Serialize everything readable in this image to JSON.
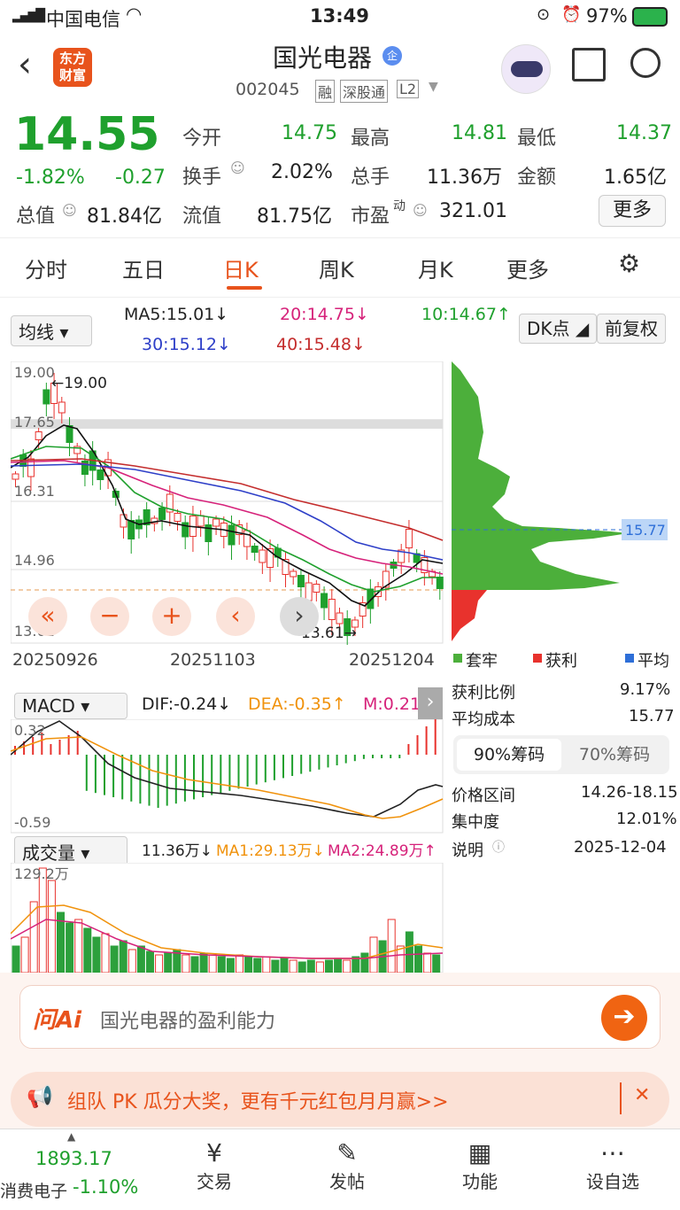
{
  "status": {
    "carrier": "中国电信",
    "time": "13:49",
    "battery": "97%"
  },
  "nav": {
    "logo_line1": "东方",
    "logo_line2": "财富",
    "stock_name": "国光电器",
    "badge": "企",
    "code": "002045",
    "tag1": "融",
    "tag2": "深股通",
    "tag3": "L2"
  },
  "quote": {
    "price": "14.55",
    "pct": "-1.82%",
    "chg": "-0.27",
    "open_label": "今开",
    "open": "14.75",
    "high_label": "最高",
    "high": "14.81",
    "low_label": "最低",
    "low": "14.37",
    "turnover_label": "换手",
    "turnover": "2.02%",
    "vol_label": "总手",
    "vol": "11.36万",
    "amount_label": "金额",
    "amount": "1.65亿",
    "mcap_label": "总值",
    "mcap": "81.84亿",
    "float_label": "流值",
    "float": "81.75亿",
    "pe_label": "市盈",
    "pe_sup": "动",
    "pe": "321.01",
    "more": "更多"
  },
  "tabs": [
    "分时",
    "五日",
    "日K",
    "周K",
    "月K",
    "更多",
    "settings-icon"
  ],
  "ma": {
    "select": "均线",
    "ma5": "MA5:15.01↓",
    "ma20": "20:14.75↓",
    "ma10": "10:14.67↑",
    "ma30": "30:15.12↓",
    "ma40": "40:15.48↓",
    "dk": "DK点",
    "fq": "前复权"
  },
  "kchart": {
    "y_top": "19.00",
    "y2": "17.65",
    "y3": "16.31",
    "y4": "14.96",
    "y_bot": "13.61",
    "hi_label": "←19.00",
    "lo_label": "13.61→",
    "dates": [
      "20250926",
      "20251103",
      "20251204"
    ]
  },
  "macd": {
    "select": "MACD",
    "dif": "DIF:-0.24↓",
    "dea": "DEA:-0.35↑",
    "m": "M:0.21↑",
    "top": "0.32",
    "bot": "-0.59"
  },
  "volume": {
    "select": "成交量",
    "val": "11.36万↓",
    "ma1": "MA1:29.13万↓",
    "ma2": "MA2:24.89万↑",
    "top": "129.2万"
  },
  "chips": {
    "price_tag": "15.77",
    "legend": [
      "套牢",
      "获利",
      "平均"
    ],
    "profit_ratio_label": "获利比例",
    "profit_ratio": "9.17%",
    "avg_cost_label": "平均成本",
    "avg_cost": "15.77",
    "tab90": "90%筹码",
    "tab70": "70%筹码",
    "range_label": "价格区间",
    "range": "14.26-18.15",
    "conc_label": "集中度",
    "conc": "12.01%",
    "note_label": "说明",
    "note_date": "2025-12-04"
  },
  "ai": {
    "brand": "问Ai",
    "placeholder": "国光电器的盈利能力"
  },
  "promo": {
    "text": "组队 PK 瓜分大奖，更有千元红包月月赢>>"
  },
  "bottom": {
    "index_value": "1893.17",
    "index_name": "消费电子",
    "index_pct": "-1.10%",
    "items": [
      "交易",
      "发帖",
      "功能",
      "设自选"
    ]
  },
  "colors": {
    "up": "#e8322d",
    "down": "#1fa02d",
    "accent": "#e8531c"
  }
}
